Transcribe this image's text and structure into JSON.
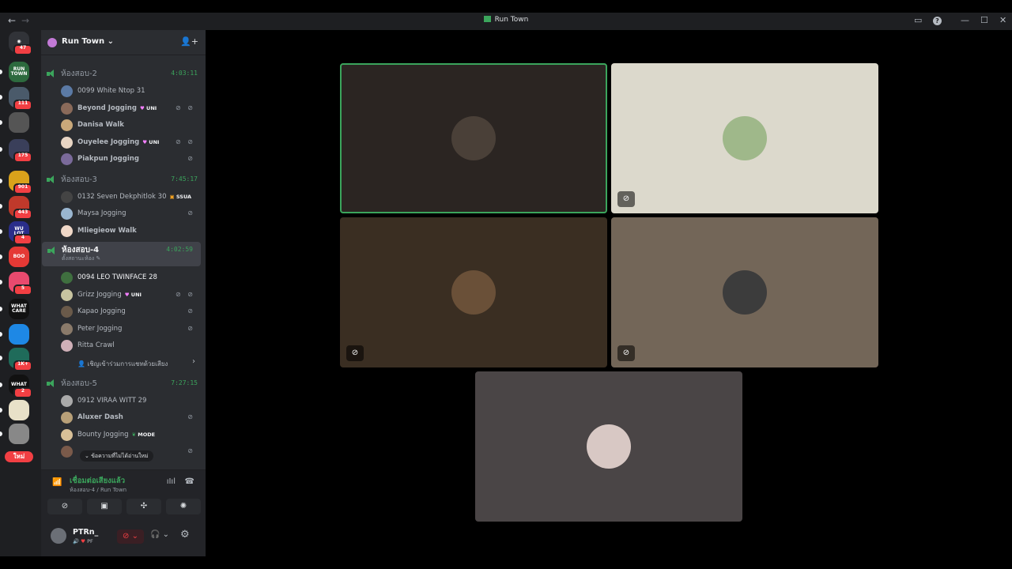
{
  "window": {
    "title": "Run Town",
    "back_icon": "←",
    "forward_icon": "→",
    "inbox_icon": "▭",
    "help_icon": "?",
    "minimize_icon": "—",
    "maximize_icon": "☐",
    "close_icon": "✕"
  },
  "rail": {
    "home_badge": "47",
    "servers": [
      {
        "label": "RUN TOWN",
        "color": "#2d6a3e",
        "badge": ""
      },
      {
        "label": "",
        "color": "#4a5a6a",
        "badge": "111"
      },
      {
        "label": "",
        "color": "#555",
        "badge": ""
      },
      {
        "label": "",
        "color": "#3a3f5a",
        "badge": "175"
      },
      {
        "label": "",
        "color": "#d9a21b",
        "badge": "901"
      },
      {
        "label": "",
        "color": "#c0392b",
        "badge": "443"
      },
      {
        "label": "WU LOT",
        "color": "#2a2e8a",
        "badge": "4"
      },
      {
        "label": "BOO",
        "color": "#e53935",
        "badge": ""
      },
      {
        "label": "",
        "color": "#e84a6e",
        "badge": "5"
      },
      {
        "label": "WHAT CARE",
        "color": "#111",
        "badge": ""
      },
      {
        "label": "",
        "color": "#1e88e5",
        "badge": ""
      },
      {
        "label": "",
        "color": "#1f6b5a",
        "badge": "1K+"
      },
      {
        "label": "WHAT",
        "color": "#111",
        "badge": "2"
      },
      {
        "label": "",
        "color": "#e8e1c8",
        "badge": ""
      },
      {
        "label": "",
        "color": "#888",
        "badge": ""
      }
    ],
    "new_label": "ใหม่"
  },
  "guild": {
    "name": "Run Town",
    "chevron": "⌄",
    "add_user_icon": "👤+"
  },
  "channels": [
    {
      "name": "ห้องสอบ-2",
      "timer": "4:03:11",
      "users": [
        {
          "name": "0099 White Ntop 31",
          "tag": "",
          "icons": "",
          "bold": false,
          "color": "#5b7aa5"
        },
        {
          "name": "Beyond Jogging",
          "tag": "UNI",
          "icons": "⊘ ⊘",
          "bold": true,
          "color": "#8a6a5a"
        },
        {
          "name": "Danisa Walk",
          "tag": "",
          "icons": "",
          "bold": true,
          "color": "#c9a87a"
        },
        {
          "name": "Ouyelee Jogging",
          "tag": "UNI",
          "icons": "⊘ ⊘",
          "bold": true,
          "color": "#e8d5c4"
        },
        {
          "name": "Piakpun Jogging",
          "tag": "",
          "icons": "⊘",
          "bold": true,
          "color": "#7a6a9a"
        }
      ]
    },
    {
      "name": "ห้องสอบ-3",
      "timer": "7:45:17",
      "users": [
        {
          "name": "0132 Seven Dekphitlok 30",
          "tag": "SSUA",
          "icons": "",
          "bold": false,
          "color": "#444"
        },
        {
          "name": "Maysa Jogging",
          "tag": "",
          "icons": "⊘",
          "bold": false,
          "color": "#9ab6d0"
        },
        {
          "name": "Mliegieow Walk",
          "tag": "",
          "icons": "",
          "bold": true,
          "color": "#f0d8c8"
        }
      ]
    },
    {
      "name": "ห้องสอบ-4",
      "timer": "4:02:59",
      "status": "ตั้งสถานะห้อง ✎",
      "users": [
        {
          "name": "0094 LEO TWINFACE 28",
          "tag": "",
          "icons": "",
          "bold": false,
          "color": "#3f6f3f"
        },
        {
          "name": "Grizz Jogging",
          "tag": "UNI",
          "icons": "⊘ ⊘",
          "bold": false,
          "color": "#c8c4a0"
        },
        {
          "name": "Kapao Jogging",
          "tag": "",
          "icons": "⊘",
          "bold": false,
          "color": "#6a5a4a"
        },
        {
          "name": "Peter Jogging",
          "tag": "",
          "icons": "⊘",
          "bold": false,
          "color": "#8a7a6a"
        },
        {
          "name": "Ritta Crawl",
          "tag": "",
          "icons": "",
          "bold": false,
          "color": "#d0b0b8"
        }
      ],
      "invite": "เชิญเข้าร่วมการแชทด้วยเสียง"
    },
    {
      "name": "ห้องสอบ-5",
      "timer": "7:27:15",
      "users": [
        {
          "name": "0912 VIRAA WITT 29",
          "tag": "",
          "icons": "",
          "bold": false,
          "color": "#aaa"
        },
        {
          "name": "Aluxer Dash",
          "tag": "",
          "icons": "⊘",
          "bold": true,
          "color": "#b8a078"
        },
        {
          "name": "Bounty Jogging",
          "tag": "MODE",
          "icons": "",
          "bold": false,
          "color": "#d8c098"
        },
        {
          "name": "",
          "tag": "",
          "icons": "⊘",
          "bold": false,
          "color": "#7a5a4a"
        }
      ]
    }
  ],
  "unread_banner": "ข้อความที่ไม่ได้อ่านใหม่",
  "voice": {
    "connected": "เชื่อมต่อเสียงแล้ว",
    "location": "ห้องสอบ-4 / Run Town",
    "signal_icon": "📶",
    "wave_icon": "ıIıl",
    "hangup_icon": "☎",
    "buttons": [
      "⊘",
      "▣",
      "✣",
      "✺"
    ]
  },
  "me": {
    "name": "PTRn_",
    "status": "PF",
    "mute_icon": "⊘ ⌄",
    "headphone_icon": "🎧 ⌄",
    "gear_icon": "⚙"
  },
  "tiles": [
    {
      "bg": "#2b2522",
      "avatar": "#4a4038",
      "speaking": true,
      "mic": ""
    },
    {
      "bg": "#dcd9cc",
      "avatar": "#9fb88a",
      "speaking": false,
      "mic": "⊘"
    },
    {
      "bg": "#3a2e22",
      "avatar": "#6a5038",
      "speaking": false,
      "mic": "⊘"
    },
    {
      "bg": "#736658",
      "avatar": "#3c3c3c",
      "speaking": false,
      "mic": "⊘"
    },
    {
      "bg": "#4a4546",
      "avatar": "#d8c8c4",
      "speaking": false,
      "mic": ""
    }
  ]
}
